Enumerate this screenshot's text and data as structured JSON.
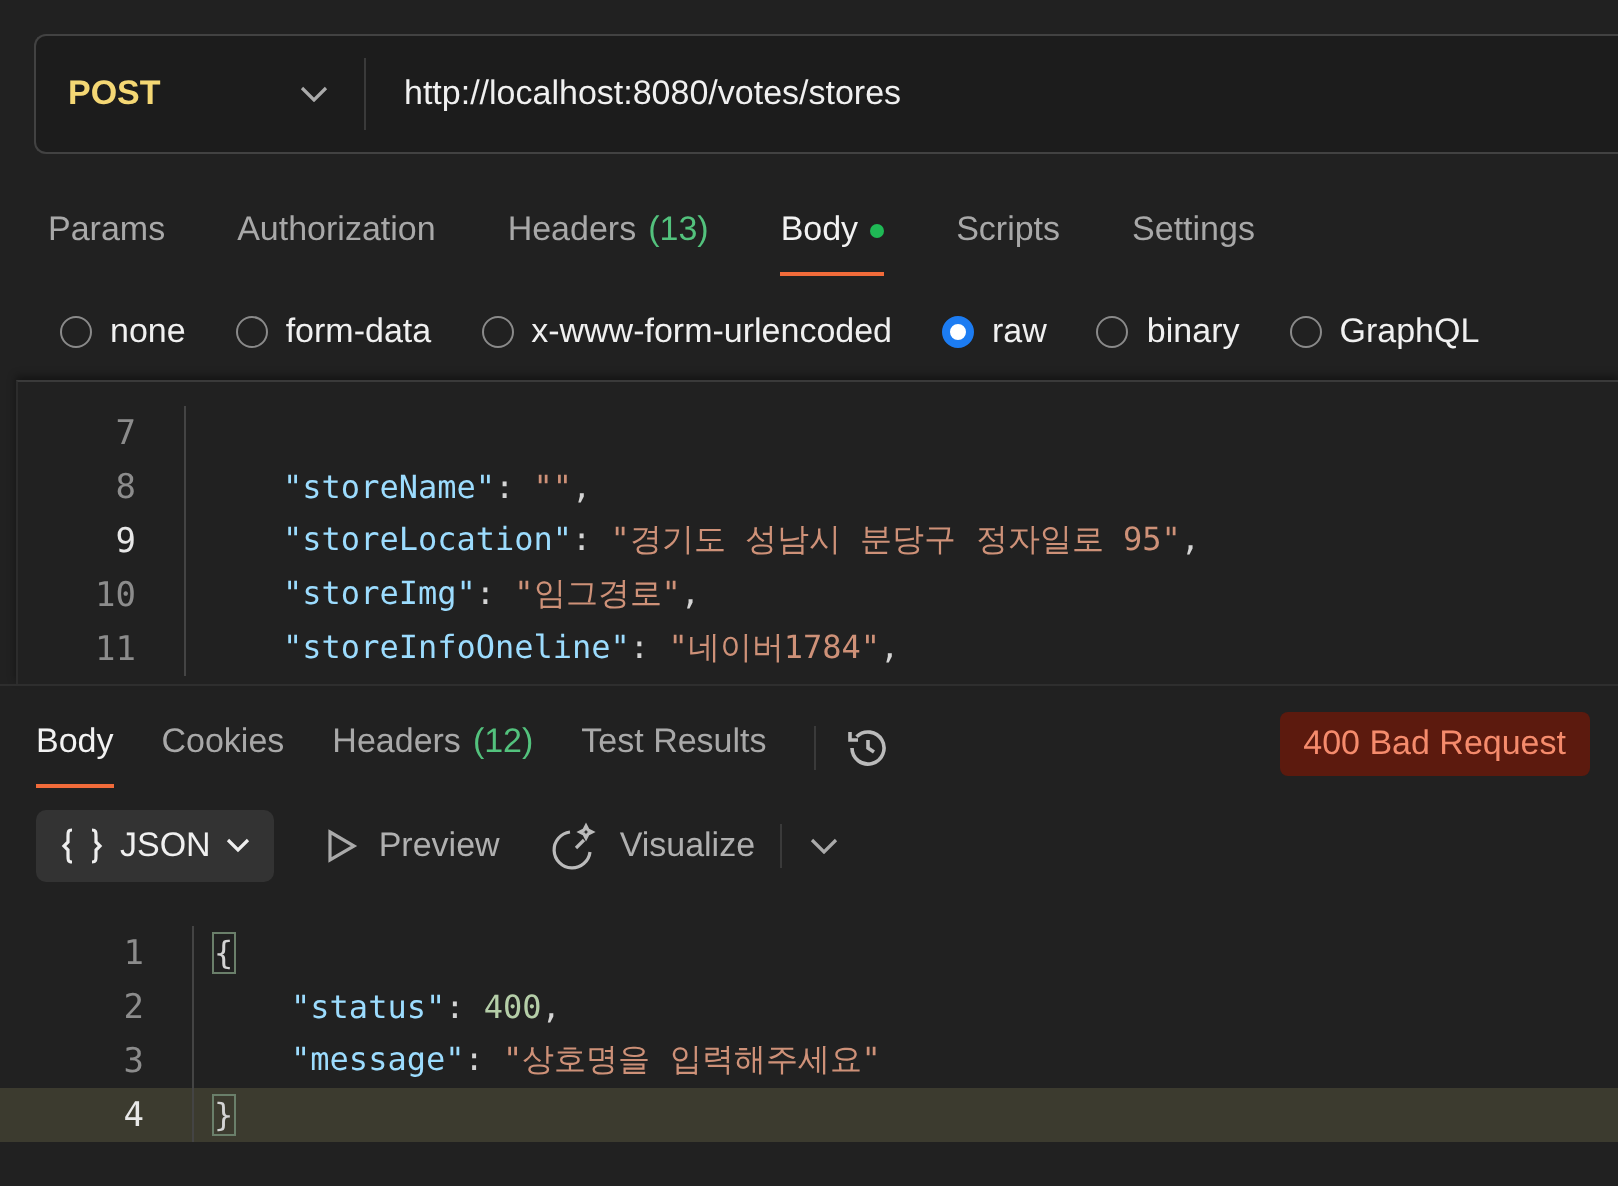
{
  "request": {
    "method": "POST",
    "url": "http://localhost:8080/votes/stores"
  },
  "request_tabs": [
    {
      "label": "Params",
      "selected": false
    },
    {
      "label": "Authorization",
      "selected": false
    },
    {
      "label": "Headers",
      "count": "(13)",
      "selected": false
    },
    {
      "label": "Body",
      "selected": true,
      "has_content": true
    },
    {
      "label": "Scripts",
      "selected": false
    },
    {
      "label": "Settings",
      "selected": false
    }
  ],
  "body_types": [
    {
      "label": "none",
      "selected": false
    },
    {
      "label": "form-data",
      "selected": false
    },
    {
      "label": "x-www-form-urlencoded",
      "selected": false
    },
    {
      "label": "raw",
      "selected": true
    },
    {
      "label": "binary",
      "selected": false
    },
    {
      "label": "GraphQL",
      "selected": false
    }
  ],
  "request_body": [
    {
      "number": "7",
      "selected": false
    },
    {
      "number": "8",
      "selected": false,
      "tokens": [
        {
          "kind": "key",
          "text": "    \"storeName\""
        },
        {
          "kind": "punct",
          "text": ": "
        },
        {
          "kind": "string",
          "text": "\"\""
        },
        {
          "kind": "punct",
          "text": ","
        }
      ]
    },
    {
      "number": "9",
      "selected": true,
      "tokens": [
        {
          "kind": "key",
          "text": "    \"storeLocation\""
        },
        {
          "kind": "punct",
          "text": ": "
        },
        {
          "kind": "string",
          "text": "\"경기도 성남시 분당구 정자일로 95\""
        },
        {
          "kind": "punct",
          "text": ","
        }
      ]
    },
    {
      "number": "10",
      "selected": false,
      "tokens": [
        {
          "kind": "key",
          "text": "    \"storeImg\""
        },
        {
          "kind": "punct",
          "text": ": "
        },
        {
          "kind": "string",
          "text": "\"임그경로\""
        },
        {
          "kind": "punct",
          "text": ","
        }
      ]
    },
    {
      "number": "11",
      "selected": false,
      "tokens": [
        {
          "kind": "key",
          "text": "    \"storeInfoOneline\""
        },
        {
          "kind": "punct",
          "text": ": "
        },
        {
          "kind": "string",
          "text": "\"네이버1784\""
        },
        {
          "kind": "punct",
          "text": ","
        }
      ]
    }
  ],
  "response_tabs": [
    {
      "label": "Body",
      "selected": true
    },
    {
      "label": "Cookies",
      "selected": false
    },
    {
      "label": "Headers",
      "count": "(12)",
      "selected": false
    },
    {
      "label": "Test Results",
      "selected": false
    }
  ],
  "status": {
    "text": "400 Bad Request",
    "color": "#5c1a0e"
  },
  "response_toolbar": {
    "format": "JSON",
    "preview": "Preview",
    "visualize": "Visualize"
  },
  "response_body": [
    {
      "number": "1",
      "selected": false,
      "tokens": [
        {
          "kind": "brace",
          "text": "{"
        }
      ]
    },
    {
      "number": "2",
      "selected": false,
      "tokens": [
        {
          "kind": "key",
          "text": "    \"status\""
        },
        {
          "kind": "punct",
          "text": ": "
        },
        {
          "kind": "number",
          "text": "400"
        },
        {
          "kind": "punct",
          "text": ","
        }
      ]
    },
    {
      "number": "3",
      "selected": false,
      "tokens": [
        {
          "kind": "key",
          "text": "    \"message\""
        },
        {
          "kind": "punct",
          "text": ": "
        },
        {
          "kind": "string",
          "text": "\"상호명을 입력해주세요\""
        }
      ]
    },
    {
      "number": "4",
      "selected": true,
      "tokens": [
        {
          "kind": "brace",
          "text": "}"
        }
      ]
    }
  ]
}
